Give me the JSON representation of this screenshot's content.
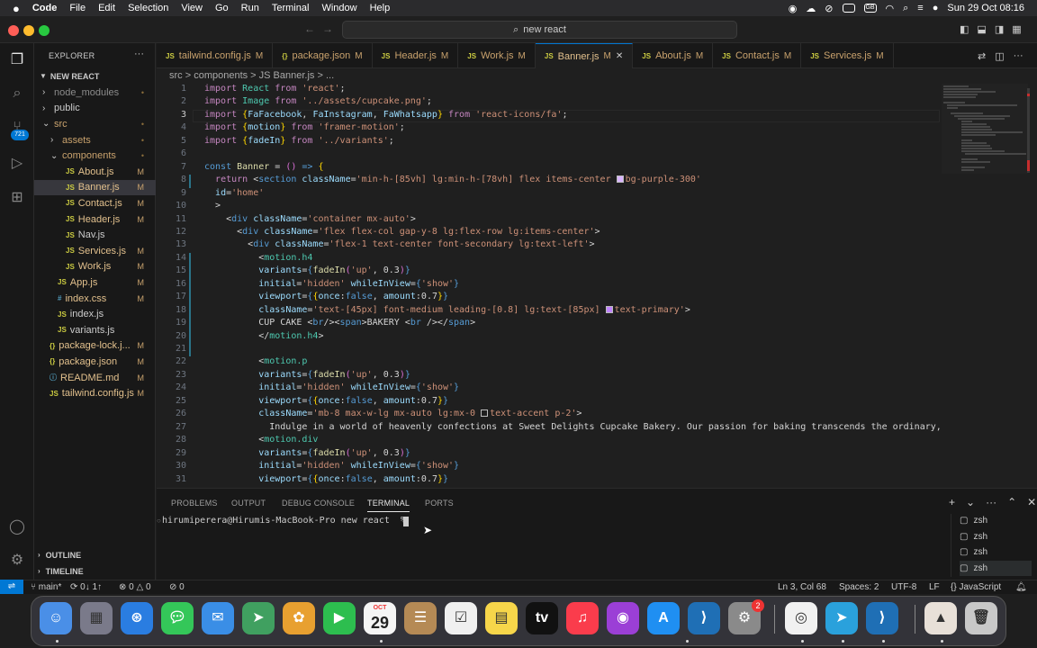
{
  "menubar": {
    "app": "Code",
    "items": [
      "File",
      "Edit",
      "Selection",
      "View",
      "Go",
      "Run",
      "Terminal",
      "Window",
      "Help"
    ],
    "datetime": "Sun 29 Oct  08:16"
  },
  "titlebar": {
    "search": "new react"
  },
  "activity": {
    "badge": "721"
  },
  "sidebar": {
    "title": "EXPLORER",
    "project": "NEW REACT",
    "items": [
      {
        "label": "node_modules",
        "indent": 1,
        "kind": "folder",
        "open": false,
        "status": "•"
      },
      {
        "label": "public",
        "indent": 1,
        "kind": "folder",
        "open": false,
        "status": ""
      },
      {
        "label": "src",
        "indent": 1,
        "kind": "folder",
        "open": true,
        "status": "•"
      },
      {
        "label": "assets",
        "indent": 2,
        "kind": "folder",
        "open": false,
        "status": "•"
      },
      {
        "label": "components",
        "indent": 2,
        "kind": "folder",
        "open": true,
        "status": "•"
      },
      {
        "label": "About.js",
        "indent": 3,
        "kind": "js",
        "status": "M"
      },
      {
        "label": "Banner.js",
        "indent": 3,
        "kind": "js",
        "status": "M",
        "selected": true
      },
      {
        "label": "Contact.js",
        "indent": 3,
        "kind": "js",
        "status": "M"
      },
      {
        "label": "Header.js",
        "indent": 3,
        "kind": "js",
        "status": "M"
      },
      {
        "label": "Nav.js",
        "indent": 3,
        "kind": "js",
        "status": ""
      },
      {
        "label": "Services.js",
        "indent": 3,
        "kind": "js",
        "status": "M"
      },
      {
        "label": "Work.js",
        "indent": 3,
        "kind": "js",
        "status": "M"
      },
      {
        "label": "App.js",
        "indent": 2,
        "kind": "js",
        "status": "M"
      },
      {
        "label": "index.css",
        "indent": 2,
        "kind": "css",
        "status": "M"
      },
      {
        "label": "index.js",
        "indent": 2,
        "kind": "js",
        "status": ""
      },
      {
        "label": "variants.js",
        "indent": 2,
        "kind": "js",
        "status": ""
      },
      {
        "label": "package-lock.j...",
        "indent": 1,
        "kind": "json",
        "status": "M"
      },
      {
        "label": "package.json",
        "indent": 1,
        "kind": "json",
        "status": "M"
      },
      {
        "label": "README.md",
        "indent": 1,
        "kind": "md",
        "status": "M"
      },
      {
        "label": "tailwind.config.js",
        "indent": 1,
        "kind": "js",
        "status": "M"
      }
    ],
    "outline": "OUTLINE",
    "timeline": "TIMELINE"
  },
  "tabs": [
    {
      "label": "tailwind.config.js",
      "mod": "M",
      "icon": "JS"
    },
    {
      "label": "package.json",
      "mod": "M",
      "icon": "{}"
    },
    {
      "label": "Header.js",
      "mod": "M",
      "icon": "JS"
    },
    {
      "label": "Work.js",
      "mod": "M",
      "icon": "JS"
    },
    {
      "label": "Banner.js",
      "mod": "M",
      "icon": "JS",
      "active": true
    },
    {
      "label": "About.js",
      "mod": "M",
      "icon": "JS"
    },
    {
      "label": "Contact.js",
      "mod": "M",
      "icon": "JS"
    },
    {
      "label": "Services.js",
      "mod": "M",
      "icon": "JS"
    }
  ],
  "breadcrumb": "src  >  components  >  JS Banner.js  >  ...",
  "code": [
    [
      [
        "k",
        "import "
      ],
      [
        "c",
        "React"
      ],
      [
        "k",
        " from "
      ],
      [
        "s",
        "'react'"
      ],
      [
        "w",
        ";"
      ]
    ],
    [
      [
        "k",
        "import "
      ],
      [
        "c",
        "Image"
      ],
      [
        "k",
        " from "
      ],
      [
        "s",
        "'../assets/cupcake.png'"
      ],
      [
        "w",
        ";"
      ]
    ],
    [
      [
        "k",
        "import "
      ],
      [
        "y",
        "{"
      ],
      [
        "a",
        "FaFacebook"
      ],
      [
        "w",
        ", "
      ],
      [
        "a",
        "FaInstagram"
      ],
      [
        "w",
        ", "
      ],
      [
        "a",
        "FaWhatsapp"
      ],
      [
        "y",
        "}"
      ],
      [
        "k",
        " from "
      ],
      [
        "s",
        "'react-icons/fa'"
      ],
      [
        "w",
        ";"
      ]
    ],
    [
      [
        "k",
        "import "
      ],
      [
        "y",
        "{"
      ],
      [
        "a",
        "motion"
      ],
      [
        "y",
        "}"
      ],
      [
        "k",
        " from "
      ],
      [
        "s",
        "'framer-motion'"
      ],
      [
        "w",
        ";"
      ]
    ],
    [
      [
        "k",
        "import "
      ],
      [
        "y",
        "{"
      ],
      [
        "a",
        "fadeIn"
      ],
      [
        "y",
        "}"
      ],
      [
        "k",
        " from "
      ],
      [
        "s",
        "'../variants'"
      ],
      [
        "w",
        ";"
      ]
    ],
    [
      [
        "w",
        ""
      ]
    ],
    [
      [
        "t",
        "const "
      ],
      [
        "f",
        "Banner"
      ],
      [
        "w",
        " = "
      ],
      [
        "b",
        "()"
      ],
      [
        "t",
        " => "
      ],
      [
        "y",
        "{"
      ]
    ],
    [
      [
        "w",
        "  "
      ],
      [
        "k",
        "return "
      ],
      [
        "w",
        "<"
      ],
      [
        "t",
        "section "
      ],
      [
        "a",
        "className"
      ],
      [
        "w",
        "="
      ],
      [
        "s",
        "'min-h-[85vh] lg:min-h-[78vh] flex items-center "
      ],
      [
        "sw",
        "#d8b4fe"
      ],
      [
        "s",
        "bg-purple-300'"
      ]
    ],
    [
      [
        "w",
        "  "
      ],
      [
        "a",
        "id"
      ],
      [
        "w",
        "="
      ],
      [
        "s",
        "'home'"
      ]
    ],
    [
      [
        "w",
        "  >"
      ]
    ],
    [
      [
        "w",
        "    <"
      ],
      [
        "t",
        "div "
      ],
      [
        "a",
        "className"
      ],
      [
        "w",
        "="
      ],
      [
        "s",
        "'container mx-auto'"
      ],
      [
        "w",
        ">"
      ]
    ],
    [
      [
        "w",
        "      <"
      ],
      [
        "t",
        "div "
      ],
      [
        "a",
        "className"
      ],
      [
        "w",
        "="
      ],
      [
        "s",
        "'flex flex-col gap-y-8 lg:flex-row lg:items-center'"
      ],
      [
        "w",
        ">"
      ]
    ],
    [
      [
        "w",
        "        <"
      ],
      [
        "t",
        "div "
      ],
      [
        "a",
        "className"
      ],
      [
        "w",
        "="
      ],
      [
        "s",
        "'flex-1 text-center font-secondary lg:text-left'"
      ],
      [
        "w",
        ">"
      ]
    ],
    [
      [
        "w",
        "          <"
      ],
      [
        "c",
        "motion.h4"
      ]
    ],
    [
      [
        "w",
        "          "
      ],
      [
        "a",
        "variants"
      ],
      [
        "w",
        "="
      ],
      [
        "t",
        "{"
      ],
      [
        "f",
        "fadeIn"
      ],
      [
        "b",
        "("
      ],
      [
        "s",
        "'up'"
      ],
      [
        "w",
        ", "
      ],
      [
        "w",
        "0.3"
      ],
      [
        "b",
        ")"
      ],
      [
        "t",
        "}"
      ]
    ],
    [
      [
        "w",
        "          "
      ],
      [
        "a",
        "initial"
      ],
      [
        "w",
        "="
      ],
      [
        "s",
        "'hidden'"
      ],
      [
        "w",
        " "
      ],
      [
        "a",
        "whileInView"
      ],
      [
        "w",
        "="
      ],
      [
        "t",
        "{"
      ],
      [
        "s",
        "'show'"
      ],
      [
        "t",
        "}"
      ]
    ],
    [
      [
        "w",
        "          "
      ],
      [
        "a",
        "viewport"
      ],
      [
        "w",
        "="
      ],
      [
        "t",
        "{"
      ],
      [
        "y",
        "{"
      ],
      [
        "a",
        "once"
      ],
      [
        "w",
        ":"
      ],
      [
        "t",
        "false"
      ],
      [
        "w",
        ", "
      ],
      [
        "a",
        "amount"
      ],
      [
        "w",
        ":"
      ],
      [
        "w",
        "0.7"
      ],
      [
        "y",
        "}"
      ],
      [
        "t",
        "}"
      ]
    ],
    [
      [
        "w",
        "          "
      ],
      [
        "a",
        "className"
      ],
      [
        "w",
        "="
      ],
      [
        "s",
        "'text-[45px] font-medium leading-[0.8] lg:text-[85px] "
      ],
      [
        "sw",
        "#c084fc"
      ],
      [
        "s",
        "text-primary'"
      ],
      [
        "w",
        ">"
      ]
    ],
    [
      [
        "w",
        "          CUP CAKE <"
      ],
      [
        "t",
        "br"
      ],
      [
        "w",
        "/><"
      ],
      [
        "t",
        "span"
      ],
      [
        "w",
        ">BAKERY <"
      ],
      [
        "t",
        "br"
      ],
      [
        "w",
        " /></"
      ],
      [
        "t",
        "span"
      ],
      [
        "w",
        ">"
      ]
    ],
    [
      [
        "w",
        "          </"
      ],
      [
        "c",
        "motion.h4"
      ],
      [
        "w",
        ">"
      ]
    ],
    [
      [
        "w",
        ""
      ]
    ],
    [
      [
        "w",
        "          <"
      ],
      [
        "c",
        "motion.p"
      ]
    ],
    [
      [
        "w",
        "          "
      ],
      [
        "a",
        "variants"
      ],
      [
        "w",
        "="
      ],
      [
        "t",
        "{"
      ],
      [
        "f",
        "fadeIn"
      ],
      [
        "b",
        "("
      ],
      [
        "s",
        "'up'"
      ],
      [
        "w",
        ", "
      ],
      [
        "w",
        "0.3"
      ],
      [
        "b",
        ")"
      ],
      [
        "t",
        "}"
      ]
    ],
    [
      [
        "w",
        "          "
      ],
      [
        "a",
        "initial"
      ],
      [
        "w",
        "="
      ],
      [
        "s",
        "'hidden'"
      ],
      [
        "w",
        " "
      ],
      [
        "a",
        "whileInView"
      ],
      [
        "w",
        "="
      ],
      [
        "t",
        "{"
      ],
      [
        "s",
        "'show'"
      ],
      [
        "t",
        "}"
      ]
    ],
    [
      [
        "w",
        "          "
      ],
      [
        "a",
        "viewport"
      ],
      [
        "w",
        "="
      ],
      [
        "t",
        "{"
      ],
      [
        "y",
        "{"
      ],
      [
        "a",
        "once"
      ],
      [
        "w",
        ":"
      ],
      [
        "t",
        "false"
      ],
      [
        "w",
        ", "
      ],
      [
        "a",
        "amount"
      ],
      [
        "w",
        ":"
      ],
      [
        "w",
        "0.7"
      ],
      [
        "y",
        "}"
      ],
      [
        "t",
        "}"
      ]
    ],
    [
      [
        "w",
        "          "
      ],
      [
        "a",
        "className"
      ],
      [
        "w",
        "="
      ],
      [
        "s",
        "'mb-8 max-w-lg mx-auto lg:mx-0 "
      ],
      [
        "sw",
        "#1f1f1f"
      ],
      [
        "s",
        "text-accent p-2'"
      ],
      [
        "w",
        ">"
      ]
    ],
    [
      [
        "w",
        "            Indulge in a world of heavenly confections at Sweet Delights Cupcake Bakery. Our passion for baking transcends the ordinary, brin"
      ]
    ],
    [
      [
        "w",
        "          <"
      ],
      [
        "c",
        "motion.div"
      ]
    ],
    [
      [
        "w",
        "          "
      ],
      [
        "a",
        "variants"
      ],
      [
        "w",
        "="
      ],
      [
        "t",
        "{"
      ],
      [
        "f",
        "fadeIn"
      ],
      [
        "b",
        "("
      ],
      [
        "s",
        "'up'"
      ],
      [
        "w",
        ", "
      ],
      [
        "w",
        "0.3"
      ],
      [
        "b",
        ")"
      ],
      [
        "t",
        "}"
      ]
    ],
    [
      [
        "w",
        "          "
      ],
      [
        "a",
        "initial"
      ],
      [
        "w",
        "="
      ],
      [
        "s",
        "'hidden'"
      ],
      [
        "w",
        " "
      ],
      [
        "a",
        "whileInView"
      ],
      [
        "w",
        "="
      ],
      [
        "t",
        "{"
      ],
      [
        "s",
        "'show'"
      ],
      [
        "t",
        "}"
      ]
    ],
    [
      [
        "w",
        "          "
      ],
      [
        "a",
        "viewport"
      ],
      [
        "w",
        "="
      ],
      [
        "t",
        "{"
      ],
      [
        "y",
        "{"
      ],
      [
        "a",
        "once"
      ],
      [
        "w",
        ":"
      ],
      [
        "t",
        "false"
      ],
      [
        "w",
        ", "
      ],
      [
        "a",
        "amount"
      ],
      [
        "w",
        ":"
      ],
      [
        "w",
        "0.7"
      ],
      [
        "y",
        "}"
      ],
      [
        "t",
        "}"
      ]
    ]
  ],
  "panel": {
    "tabs": [
      "PROBLEMS",
      "OUTPUT",
      "DEBUG CONSOLE",
      "TERMINAL",
      "PORTS"
    ],
    "active": "TERMINAL",
    "prompt": "hirumiperera@Hirumis-MacBook-Pro new react  % ",
    "shells": [
      "zsh",
      "zsh",
      "zsh",
      "zsh"
    ]
  },
  "status": {
    "branch": "main*",
    "sync": "0↓ 1↑",
    "errors": "0",
    "warnings": "0",
    "ports": "0",
    "cursor": "Ln 3, Col 68",
    "spaces": "Spaces: 2",
    "encoding": "UTF-8",
    "eol": "LF",
    "lang": "JavaScript"
  },
  "dock": {
    "calendar_month": "OCT",
    "calendar_day": "29",
    "settings_badge": "2",
    "apps": [
      "Finder",
      "Launchpad",
      "Safari",
      "Messages",
      "Mail",
      "Maps",
      "Photos",
      "FaceTime",
      "Calendar",
      "Contacts",
      "Reminders",
      "Notes",
      "TV",
      "Music",
      "Podcasts",
      "App Store",
      "VS Code",
      "System Settings",
      "Chrome",
      "Telegram",
      "VS Code",
      "VLC",
      "Trash"
    ]
  }
}
